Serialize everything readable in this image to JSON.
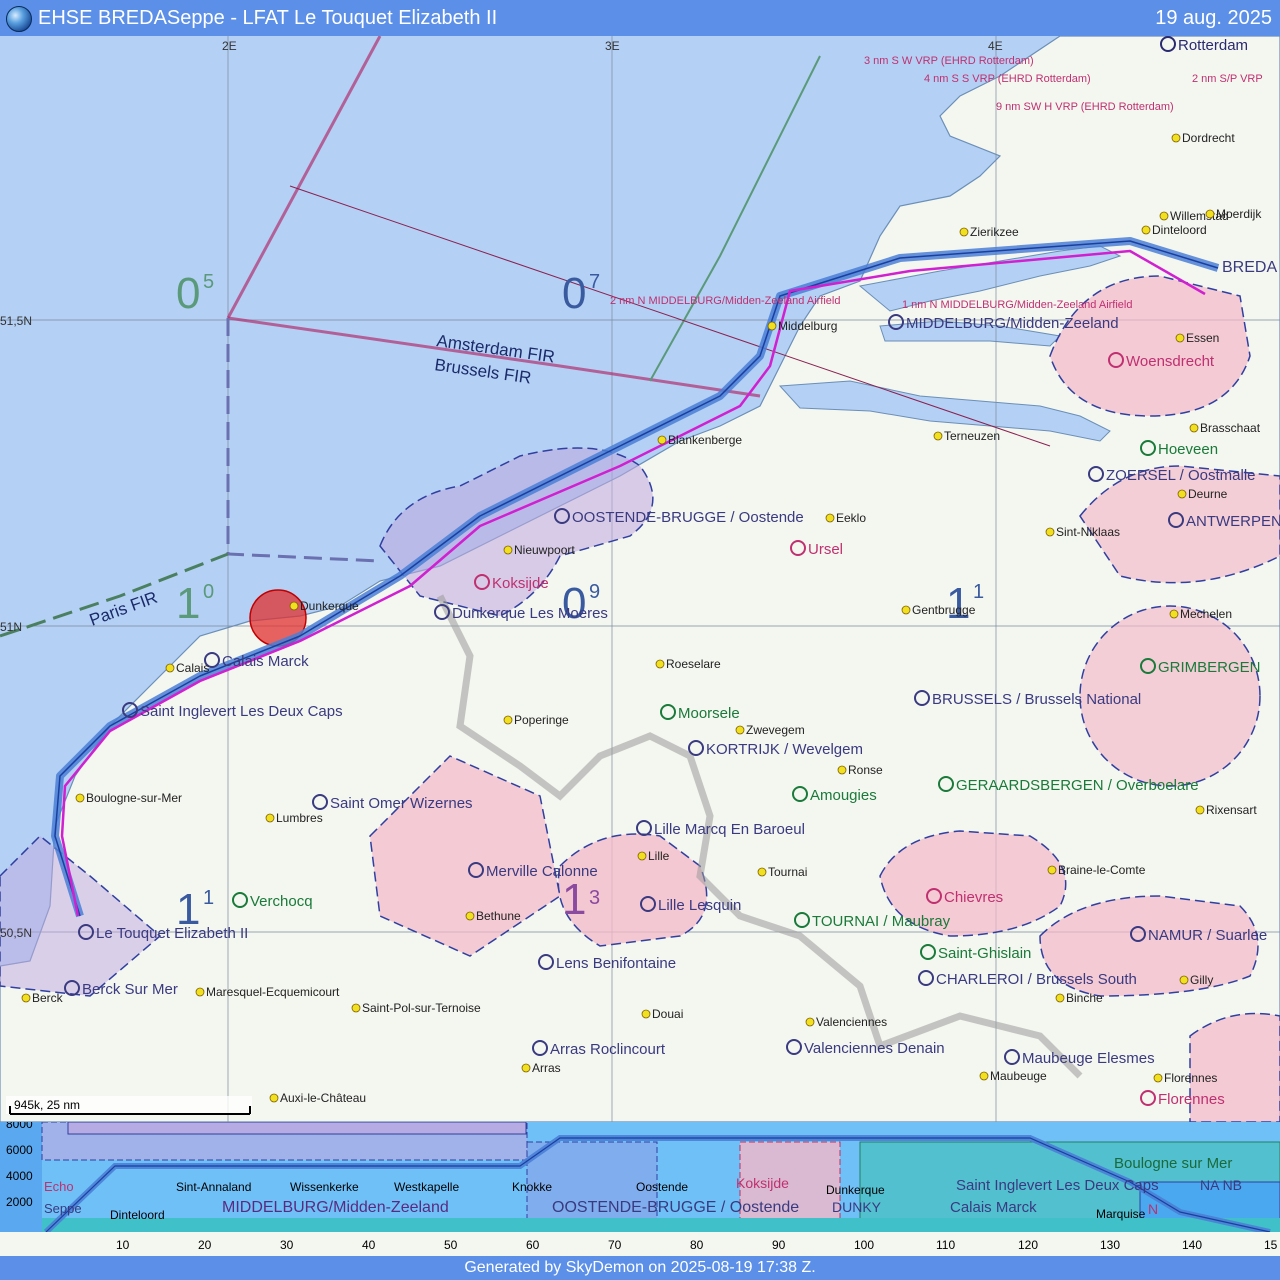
{
  "header": {
    "title": "EHSE BREDASeppe - LFAT Le Touquet Elizabeth II",
    "date": "19 aug. 2025"
  },
  "footer": {
    "text": "Generated by SkyDemon on 2025-08-19 17:38 Z."
  },
  "map": {
    "longitude_labels": [
      "2E",
      "3E",
      "4E"
    ],
    "latitude_labels": [
      "51,5N",
      "51N",
      "50,5N"
    ],
    "scale_text": "945k, 25 nm",
    "fir_labels": [
      "Amsterdam FIR",
      "Brussels FIR",
      "Paris FIR"
    ],
    "grid_altitudes": [
      {
        "major": "0",
        "minor": "5"
      },
      {
        "major": "0",
        "minor": "7"
      },
      {
        "major": "1",
        "minor": "0"
      },
      {
        "major": "0",
        "minor": "9"
      },
      {
        "major": "1",
        "minor": "1"
      },
      {
        "major": "1",
        "minor": "1"
      },
      {
        "major": "1",
        "minor": "3"
      }
    ],
    "airfields": [
      "Rotterdam",
      "MIDDELBURG/Midden-Zeeland",
      "Woensdrecht",
      "Hoeveen",
      "ZOERSEL / Oostmalle",
      "ANTWERPEN",
      "OOSTENDE-BRUGGE / Oostende",
      "Ursel",
      "Koksijde",
      "Dunkerque Les Moeres",
      "Calais Marck",
      "Saint Inglevert Les Deux Caps",
      "Moorsele",
      "KORTRIJK / Wevelgem",
      "Amougies",
      "GERAARDSBERGEN / Overboelare",
      "BRUSSELS / Brussels National",
      "GRIMBERGEN",
      "Saint Omer Wizernes",
      "Lille Marcq En Baroeul",
      "Merville Calonne",
      "Lille Lesquin",
      "Chievres",
      "TOURNAI / Maubray",
      "Saint-Ghislain",
      "CHARLEROI / Brussels South",
      "NAMUR / Suarlee",
      "Verchocq",
      "Le Touquet Elizabeth II",
      "Lens Benifontaine",
      "Berck Sur Mer",
      "Arras Roclincourt",
      "Valenciennes Denain",
      "Maubeuge Elesmes",
      "Florennes"
    ],
    "towns": [
      "Zierikzee",
      "Dinteloord",
      "Willemstad",
      "Moerdijk",
      "Dordrecht",
      "Middelburg",
      "Terneuzen",
      "Essen",
      "Brasschaat",
      "Deurne",
      "Sint-Niklaas",
      "Blankenberge",
      "Nieuwpoort",
      "Eeklo",
      "Gentbrugge",
      "Mechelen",
      "Dunkerque",
      "Calais",
      "Roeselare",
      "Poperinge",
      "Zwevegem",
      "Ronse",
      "Rixensart",
      "Braine-le-Comte",
      "Binche",
      "Gilly",
      "Boulogne-sur-Mer",
      "Lumbres",
      "Lille",
      "Tournai",
      "Bethune",
      "Maresquel-Ecquemicourt",
      "Saint-Pol-sur-Ternoise",
      "Douai",
      "Arras",
      "Valenciennes",
      "Maubeuge",
      "Florennes",
      "Berck",
      "Auxi-le-Château"
    ],
    "vrp_labels": [
      "3 nm S W VRP (EHRD Rotterdam)",
      "4 nm S S VRP (EHRD Rotterdam)",
      "2 nm S/P VRP",
      "9 nm SW H VRP (EHRD Rotterdam)",
      "2 nm N MIDDELBURG/Midden-Zeeland Airfield",
      "1 nm N MIDDELBURG/Midden-Zeeland Airfield"
    ],
    "bredap_label": "BREDA",
    "colors": {
      "sea": "#b4d0f4",
      "land": "#f4f6f0",
      "route": "#4a7fd6",
      "route_track": "#d020d0",
      "airspace_pink": "#f4b8c8",
      "airspace_purple": "#c0a8e0"
    }
  },
  "profile": {
    "altitude_labels": [
      "8000",
      "6000",
      "4000",
      "2000"
    ],
    "distance_labels": [
      "10",
      "20",
      "30",
      "40",
      "50",
      "60",
      "70",
      "80",
      "90",
      "100",
      "110",
      "120",
      "130",
      "140",
      "15"
    ],
    "waypoint_names": [
      "Dinteloord",
      "Sint-Annaland",
      "Wissenkerke",
      "Westkapelle",
      "Knokke",
      "Oostende",
      "Dunkerque",
      "Marquise"
    ],
    "airspace_labels": [
      "MIDDELBURG/Midden-Zeeland",
      "OOSTENDE-BRUGGE / Oostende",
      "Koksijde",
      "DUNKY",
      "Calais Marck",
      "Saint Inglevert Les Deux Caps",
      "Boulogne sur Mer",
      "NA NB",
      "N",
      "Echo",
      "Seppe"
    ]
  }
}
